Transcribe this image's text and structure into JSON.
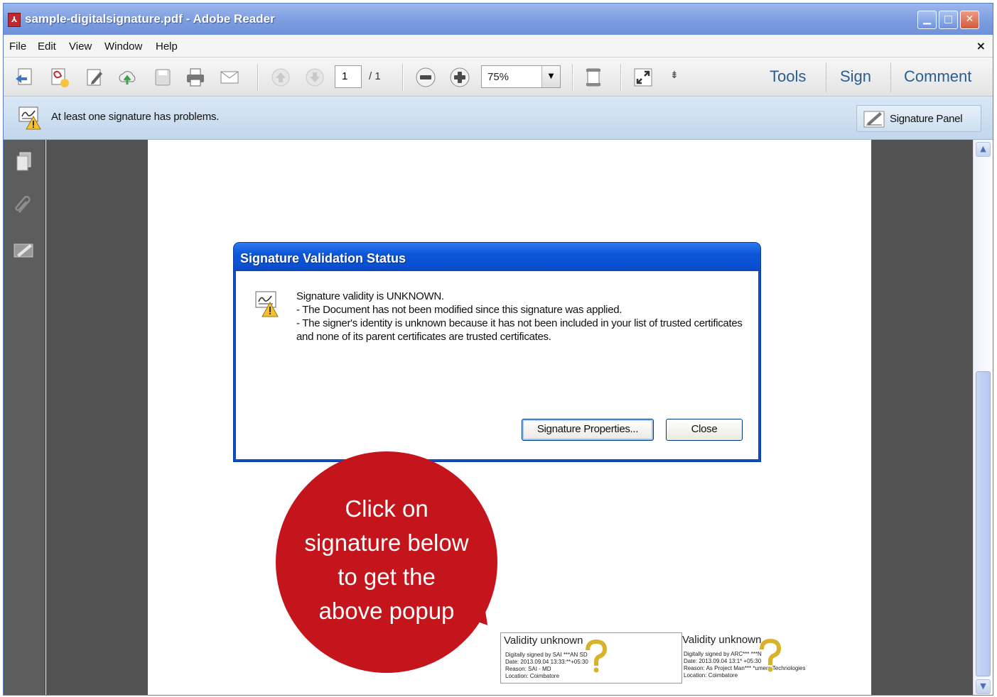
{
  "window": {
    "title": "sample-digitalsignature.pdf - Adobe Reader",
    "app_icon": "pdf-icon"
  },
  "menubar": {
    "items": [
      "File",
      "Edit",
      "View",
      "Window",
      "Help"
    ],
    "close_glyph": "×"
  },
  "toolbar": {
    "page_current": "1",
    "page_total": "/ 1",
    "zoom": "75%",
    "pane_links": [
      "Tools",
      "Sign",
      "Comment"
    ],
    "overflow_glyph": "⇟"
  },
  "notification": {
    "message": "At least one signature has problems.",
    "signature_panel_label": "Signature Panel"
  },
  "dialog": {
    "title": "Signature Validation Status",
    "lines": [
      "Signature validity is UNKNOWN.",
      "- The Document has not been modified since this signature was applied.",
      "- The signer's identity is unknown because it has not been included in your list of trusted certificates and none of its parent certificates are trusted certificates."
    ],
    "buttons": {
      "properties": "Signature Properties...",
      "close": "Close"
    }
  },
  "callout": {
    "lines": [
      "Click on",
      "signature below",
      "to get the",
      "above popup"
    ],
    "color": "#c4151c"
  },
  "signatures": [
    {
      "status": "Validity unknown",
      "details": [
        "Digitally signed by SAI ***AN SD",
        "Date: 2013.09.04 13:33:**+05:30",
        "Reason: SAI - MD",
        "Location: Coimbatore"
      ]
    },
    {
      "status": "Validity unknown",
      "details": [
        "Digitally signed by ARC*** ***N",
        "Date: 2013.09.04 13:1* +05:30",
        "Reason: As Project Man*** *umers Technologies",
        "Location: Coimbatore"
      ]
    }
  ],
  "colors": {
    "title_bar": "#7d9de0",
    "dialog_title": "#0a4fd0",
    "link": "#2a5d92",
    "doc_background": "#535353"
  }
}
